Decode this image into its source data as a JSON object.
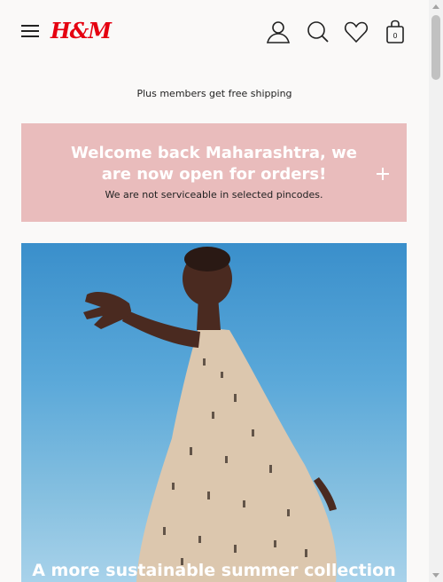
{
  "header": {
    "logo": "H&M",
    "bag_count": "0",
    "icons": [
      "menu-icon",
      "account-icon",
      "search-icon",
      "heart-icon",
      "bag-icon"
    ],
    "brand_color": "#e50010"
  },
  "promo": {
    "text": "Plus members get free shipping"
  },
  "welcome_banner": {
    "title": "Welcome back Maharashtra, we are now open for orders!",
    "subtitle": "We are not serviceable in selected pincodes.",
    "background": "#e9bcbc"
  },
  "hero": {
    "caption": "A more sustainable summer collection"
  }
}
